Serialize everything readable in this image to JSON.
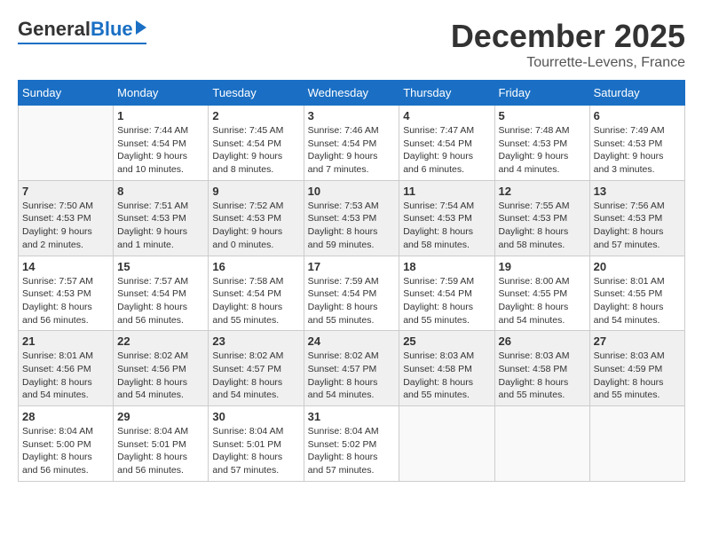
{
  "header": {
    "logo_general": "General",
    "logo_blue": "Blue",
    "month": "December 2025",
    "location": "Tourrette-Levens, France"
  },
  "weekdays": [
    "Sunday",
    "Monday",
    "Tuesday",
    "Wednesday",
    "Thursday",
    "Friday",
    "Saturday"
  ],
  "weeks": [
    [
      {
        "day": "",
        "info": ""
      },
      {
        "day": "1",
        "info": "Sunrise: 7:44 AM\nSunset: 4:54 PM\nDaylight: 9 hours\nand 10 minutes."
      },
      {
        "day": "2",
        "info": "Sunrise: 7:45 AM\nSunset: 4:54 PM\nDaylight: 9 hours\nand 8 minutes."
      },
      {
        "day": "3",
        "info": "Sunrise: 7:46 AM\nSunset: 4:54 PM\nDaylight: 9 hours\nand 7 minutes."
      },
      {
        "day": "4",
        "info": "Sunrise: 7:47 AM\nSunset: 4:54 PM\nDaylight: 9 hours\nand 6 minutes."
      },
      {
        "day": "5",
        "info": "Sunrise: 7:48 AM\nSunset: 4:53 PM\nDaylight: 9 hours\nand 4 minutes."
      },
      {
        "day": "6",
        "info": "Sunrise: 7:49 AM\nSunset: 4:53 PM\nDaylight: 9 hours\nand 3 minutes."
      }
    ],
    [
      {
        "day": "7",
        "info": "Sunrise: 7:50 AM\nSunset: 4:53 PM\nDaylight: 9 hours\nand 2 minutes."
      },
      {
        "day": "8",
        "info": "Sunrise: 7:51 AM\nSunset: 4:53 PM\nDaylight: 9 hours\nand 1 minute."
      },
      {
        "day": "9",
        "info": "Sunrise: 7:52 AM\nSunset: 4:53 PM\nDaylight: 9 hours\nand 0 minutes."
      },
      {
        "day": "10",
        "info": "Sunrise: 7:53 AM\nSunset: 4:53 PM\nDaylight: 8 hours\nand 59 minutes."
      },
      {
        "day": "11",
        "info": "Sunrise: 7:54 AM\nSunset: 4:53 PM\nDaylight: 8 hours\nand 58 minutes."
      },
      {
        "day": "12",
        "info": "Sunrise: 7:55 AM\nSunset: 4:53 PM\nDaylight: 8 hours\nand 58 minutes."
      },
      {
        "day": "13",
        "info": "Sunrise: 7:56 AM\nSunset: 4:53 PM\nDaylight: 8 hours\nand 57 minutes."
      }
    ],
    [
      {
        "day": "14",
        "info": "Sunrise: 7:57 AM\nSunset: 4:53 PM\nDaylight: 8 hours\nand 56 minutes."
      },
      {
        "day": "15",
        "info": "Sunrise: 7:57 AM\nSunset: 4:54 PM\nDaylight: 8 hours\nand 56 minutes."
      },
      {
        "day": "16",
        "info": "Sunrise: 7:58 AM\nSunset: 4:54 PM\nDaylight: 8 hours\nand 55 minutes."
      },
      {
        "day": "17",
        "info": "Sunrise: 7:59 AM\nSunset: 4:54 PM\nDaylight: 8 hours\nand 55 minutes."
      },
      {
        "day": "18",
        "info": "Sunrise: 7:59 AM\nSunset: 4:54 PM\nDaylight: 8 hours\nand 55 minutes."
      },
      {
        "day": "19",
        "info": "Sunrise: 8:00 AM\nSunset: 4:55 PM\nDaylight: 8 hours\nand 54 minutes."
      },
      {
        "day": "20",
        "info": "Sunrise: 8:01 AM\nSunset: 4:55 PM\nDaylight: 8 hours\nand 54 minutes."
      }
    ],
    [
      {
        "day": "21",
        "info": "Sunrise: 8:01 AM\nSunset: 4:56 PM\nDaylight: 8 hours\nand 54 minutes."
      },
      {
        "day": "22",
        "info": "Sunrise: 8:02 AM\nSunset: 4:56 PM\nDaylight: 8 hours\nand 54 minutes."
      },
      {
        "day": "23",
        "info": "Sunrise: 8:02 AM\nSunset: 4:57 PM\nDaylight: 8 hours\nand 54 minutes."
      },
      {
        "day": "24",
        "info": "Sunrise: 8:02 AM\nSunset: 4:57 PM\nDaylight: 8 hours\nand 54 minutes."
      },
      {
        "day": "25",
        "info": "Sunrise: 8:03 AM\nSunset: 4:58 PM\nDaylight: 8 hours\nand 55 minutes."
      },
      {
        "day": "26",
        "info": "Sunrise: 8:03 AM\nSunset: 4:58 PM\nDaylight: 8 hours\nand 55 minutes."
      },
      {
        "day": "27",
        "info": "Sunrise: 8:03 AM\nSunset: 4:59 PM\nDaylight: 8 hours\nand 55 minutes."
      }
    ],
    [
      {
        "day": "28",
        "info": "Sunrise: 8:04 AM\nSunset: 5:00 PM\nDaylight: 8 hours\nand 56 minutes."
      },
      {
        "day": "29",
        "info": "Sunrise: 8:04 AM\nSunset: 5:01 PM\nDaylight: 8 hours\nand 56 minutes."
      },
      {
        "day": "30",
        "info": "Sunrise: 8:04 AM\nSunset: 5:01 PM\nDaylight: 8 hours\nand 57 minutes."
      },
      {
        "day": "31",
        "info": "Sunrise: 8:04 AM\nSunset: 5:02 PM\nDaylight: 8 hours\nand 57 minutes."
      },
      {
        "day": "",
        "info": ""
      },
      {
        "day": "",
        "info": ""
      },
      {
        "day": "",
        "info": ""
      }
    ]
  ]
}
